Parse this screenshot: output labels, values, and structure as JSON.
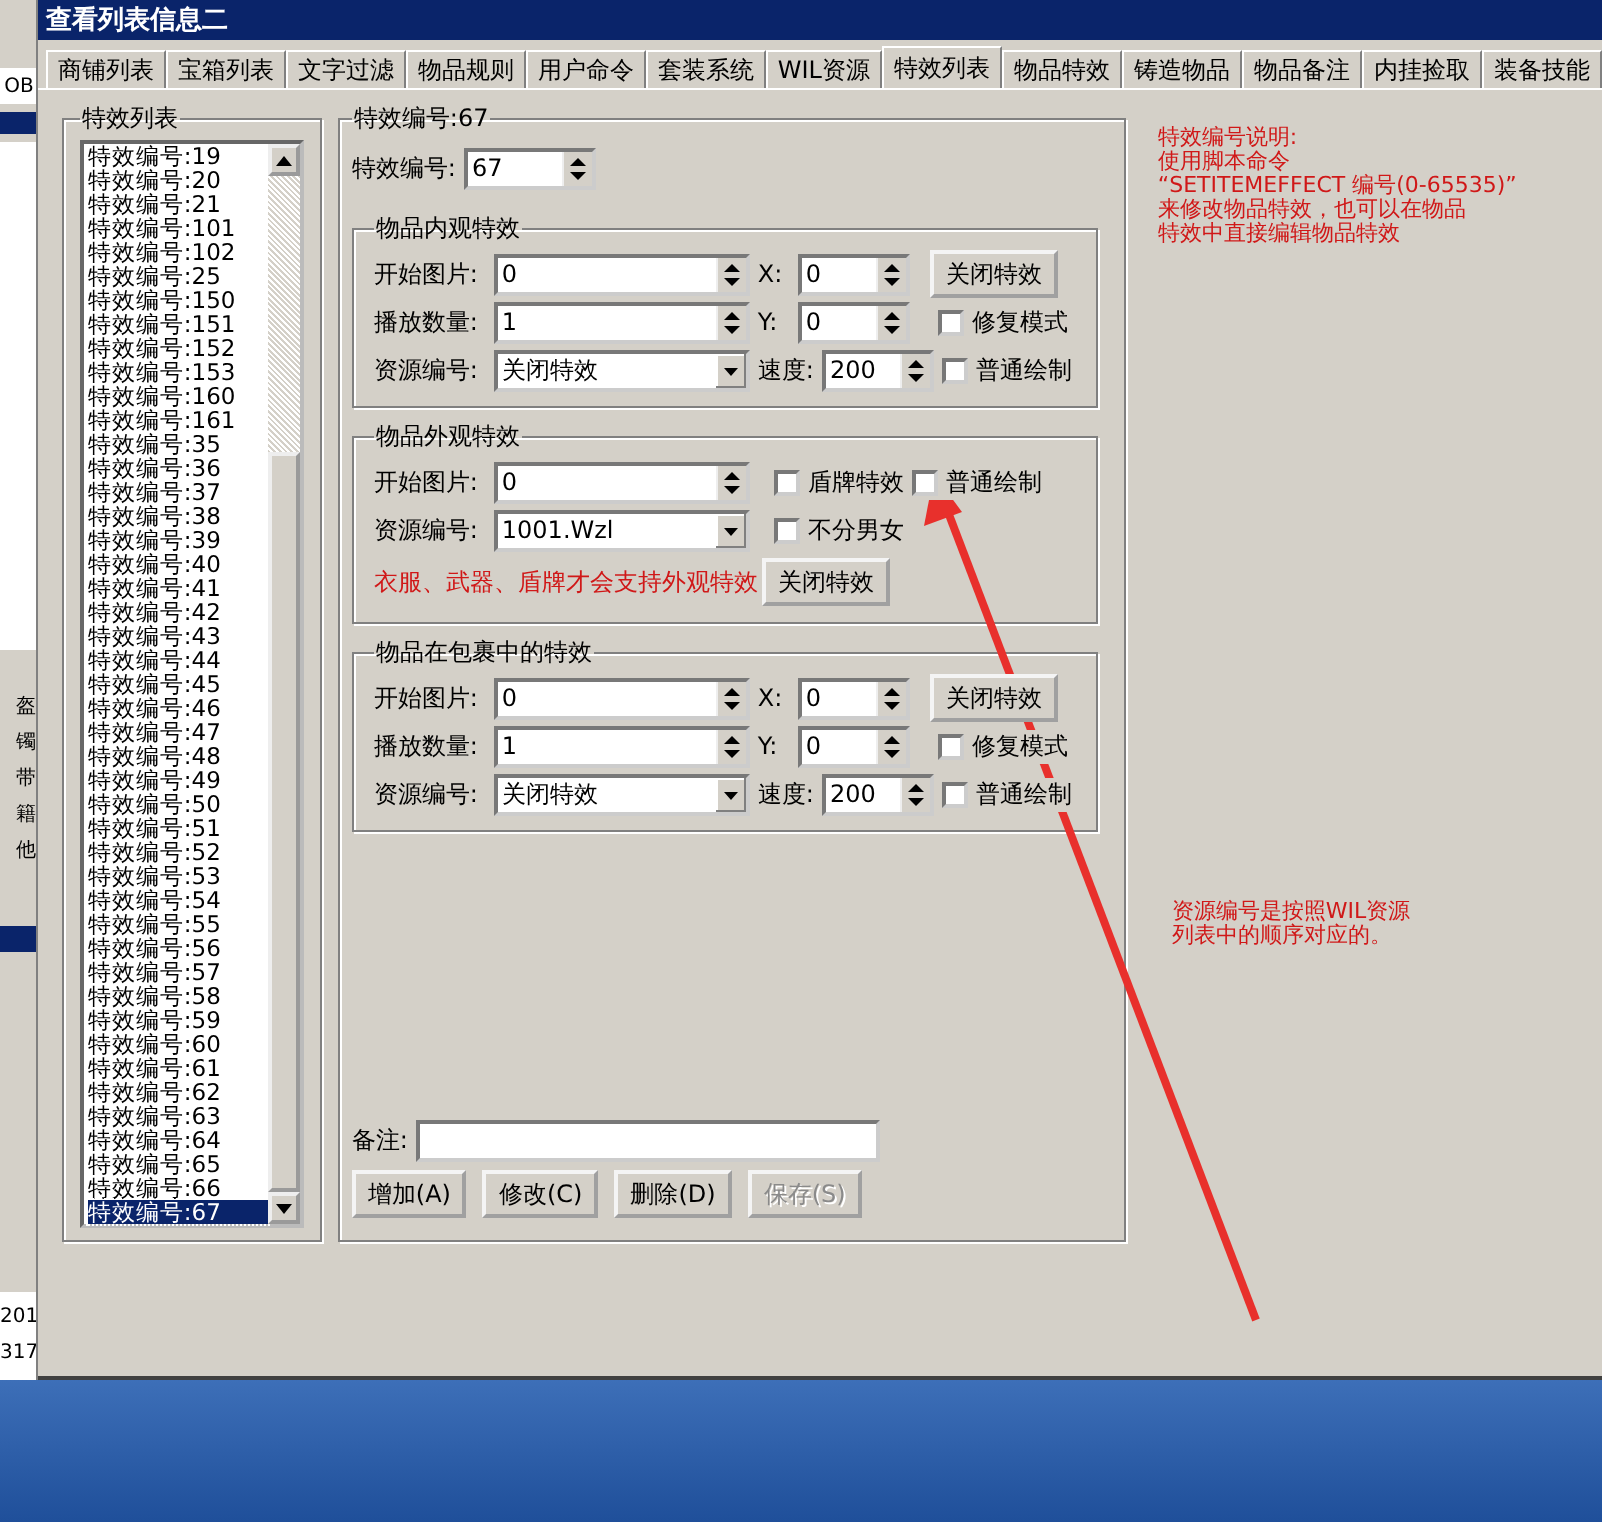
{
  "window": {
    "title": "查看列表信息二"
  },
  "background_window": {
    "field_text": "OB",
    "items": [
      "盔",
      "镯",
      "带",
      "籍",
      "他"
    ],
    "numbers": [
      "201",
      "317"
    ]
  },
  "tabs": [
    {
      "label": "商铺列表",
      "selected": false
    },
    {
      "label": "宝箱列表",
      "selected": false
    },
    {
      "label": "文字过滤",
      "selected": false
    },
    {
      "label": "物品规则",
      "selected": false
    },
    {
      "label": "用户命令",
      "selected": false
    },
    {
      "label": "套装系统",
      "selected": false
    },
    {
      "label": "WIL资源",
      "selected": false
    },
    {
      "label": "特效列表",
      "selected": true
    },
    {
      "label": "物品特效",
      "selected": false
    },
    {
      "label": "铸造物品",
      "selected": false
    },
    {
      "label": "物品备注",
      "selected": false
    },
    {
      "label": "内挂捡取",
      "selected": false
    },
    {
      "label": "装备技能",
      "selected": false
    }
  ],
  "effect_list": {
    "title": "特效列表",
    "items": [
      {
        "label": "特效编号:19",
        "selected": false
      },
      {
        "label": "特效编号:20",
        "selected": false
      },
      {
        "label": "特效编号:21",
        "selected": false
      },
      {
        "label": "特效编号:101",
        "selected": false
      },
      {
        "label": "特效编号:102",
        "selected": false
      },
      {
        "label": "特效编号:25",
        "selected": false
      },
      {
        "label": "特效编号:150",
        "selected": false
      },
      {
        "label": "特效编号:151",
        "selected": false
      },
      {
        "label": "特效编号:152",
        "selected": false
      },
      {
        "label": "特效编号:153",
        "selected": false
      },
      {
        "label": "特效编号:160",
        "selected": false
      },
      {
        "label": "特效编号:161",
        "selected": false
      },
      {
        "label": "特效编号:35",
        "selected": false
      },
      {
        "label": "特效编号:36",
        "selected": false
      },
      {
        "label": "特效编号:37",
        "selected": false
      },
      {
        "label": "特效编号:38",
        "selected": false
      },
      {
        "label": "特效编号:39",
        "selected": false
      },
      {
        "label": "特效编号:40",
        "selected": false
      },
      {
        "label": "特效编号:41",
        "selected": false
      },
      {
        "label": "特效编号:42",
        "selected": false
      },
      {
        "label": "特效编号:43",
        "selected": false
      },
      {
        "label": "特效编号:44",
        "selected": false
      },
      {
        "label": "特效编号:45",
        "selected": false
      },
      {
        "label": "特效编号:46",
        "selected": false
      },
      {
        "label": "特效编号:47",
        "selected": false
      },
      {
        "label": "特效编号:48",
        "selected": false
      },
      {
        "label": "特效编号:49",
        "selected": false
      },
      {
        "label": "特效编号:50",
        "selected": false
      },
      {
        "label": "特效编号:51",
        "selected": false
      },
      {
        "label": "特效编号:52",
        "selected": false
      },
      {
        "label": "特效编号:53",
        "selected": false
      },
      {
        "label": "特效编号:54",
        "selected": false
      },
      {
        "label": "特效编号:55",
        "selected": false
      },
      {
        "label": "特效编号:56",
        "selected": false
      },
      {
        "label": "特效编号:57",
        "selected": false
      },
      {
        "label": "特效编号:58",
        "selected": false
      },
      {
        "label": "特效编号:59",
        "selected": false
      },
      {
        "label": "特效编号:60",
        "selected": false
      },
      {
        "label": "特效编号:61",
        "selected": false
      },
      {
        "label": "特效编号:62",
        "selected": false
      },
      {
        "label": "特效编号:63",
        "selected": false
      },
      {
        "label": "特效编号:64",
        "selected": false
      },
      {
        "label": "特效编号:65",
        "selected": false
      },
      {
        "label": "特效编号:66",
        "selected": false
      },
      {
        "label": "特效编号:67",
        "selected": true
      }
    ]
  },
  "editor": {
    "title": "特效编号:67",
    "id_label": "特效编号:",
    "id_value": "67",
    "sections": [
      {
        "kind": "full",
        "title": "物品内观特效",
        "start_label": "开始图片:",
        "start_value": "0",
        "x_label": "X:",
        "x_value": "0",
        "close_button": "关闭特效",
        "count_label": "播放数量:",
        "count_value": "1",
        "y_label": "Y:",
        "y_value": "0",
        "repair": {
          "label": "修复模式",
          "checked": false
        },
        "source_label": "资源编号:",
        "source_value": "关闭特效",
        "speed_label": "速度:",
        "speed_value": "200",
        "normal": {
          "label": "普通绘制",
          "checked": false
        }
      },
      {
        "kind": "outer",
        "title": "物品外观特效",
        "start_label": "开始图片:",
        "start_value": "0",
        "shield": {
          "label": "盾牌特效",
          "checked": false
        },
        "normal": {
          "label": "普通绘制",
          "checked": false
        },
        "source_label": "资源编号:",
        "source_value": "1001.Wzl",
        "unisex": {
          "label": "不分男女",
          "checked": false
        },
        "warning": "衣服、武器、盾牌才会支持外观特效",
        "close_button": "关闭特效"
      },
      {
        "kind": "full",
        "title": "物品在包裹中的特效",
        "start_label": "开始图片:",
        "start_value": "0",
        "x_label": "X:",
        "x_value": "0",
        "close_button": "关闭特效",
        "count_label": "播放数量:",
        "count_value": "1",
        "y_label": "Y:",
        "y_value": "0",
        "repair": {
          "label": "修复模式",
          "checked": false
        },
        "source_label": "资源编号:",
        "source_value": "关闭特效",
        "speed_label": "速度:",
        "speed_value": "200",
        "normal": {
          "label": "普通绘制",
          "checked": false
        }
      }
    ],
    "remark_label": "备注:",
    "buttons": [
      {
        "label": "增加(A)",
        "disabled": false
      },
      {
        "label": "修改(C)",
        "disabled": false
      },
      {
        "label": "删除(D)",
        "disabled": false
      },
      {
        "label": "保存(S)",
        "disabled": true
      }
    ]
  },
  "notes": [
    [
      "特效编号说明:",
      "使用脚本命令",
      "“SETITEMEFFECT  编号(0-65535)”",
      "来修改物品特效，也可以在物品",
      "特效中直接编辑物品特效"
    ],
    [
      "资源编号是按照WIL资源",
      "列表中的顺序对应的。"
    ]
  ]
}
